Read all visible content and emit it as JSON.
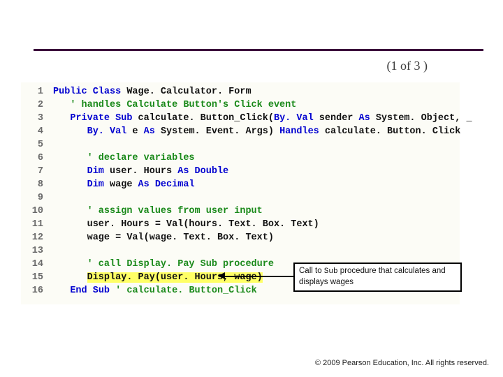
{
  "pager": "(1 of 3 )",
  "code": {
    "lines": [
      {
        "n": "1",
        "segs": [
          [
            "kw",
            "Public Class"
          ],
          [
            "id",
            " Wage. Calculator. Form"
          ]
        ]
      },
      {
        "n": "2",
        "indent": 1,
        "segs": [
          [
            "cm",
            "' handles Calculate Button's Click event"
          ]
        ]
      },
      {
        "n": "3",
        "indent": 1,
        "segs": [
          [
            "kw",
            "Private Sub"
          ],
          [
            "id",
            " calculate. Button_Click("
          ],
          [
            "kw",
            "By. Val"
          ],
          [
            "id",
            " sender "
          ],
          [
            "kw",
            "As"
          ],
          [
            "id",
            " System. Object, _"
          ]
        ]
      },
      {
        "n": "4",
        "indent": 2,
        "segs": [
          [
            "kw",
            "By. Val"
          ],
          [
            "id",
            " e "
          ],
          [
            "kw",
            "As"
          ],
          [
            "id",
            " System. Event. Args) "
          ],
          [
            "kw",
            "Handles"
          ],
          [
            "id",
            " calculate. Button. Click"
          ]
        ]
      },
      {
        "n": "5",
        "segs": []
      },
      {
        "n": "6",
        "indent": 2,
        "segs": [
          [
            "cm",
            "' declare variables"
          ]
        ]
      },
      {
        "n": "7",
        "indent": 2,
        "segs": [
          [
            "kw",
            "Dim"
          ],
          [
            "id",
            " user. Hours "
          ],
          [
            "kw",
            "As Double"
          ]
        ]
      },
      {
        "n": "8",
        "indent": 2,
        "segs": [
          [
            "kw",
            "Dim"
          ],
          [
            "id",
            " wage "
          ],
          [
            "kw",
            "As Decimal"
          ]
        ]
      },
      {
        "n": "9",
        "segs": []
      },
      {
        "n": "10",
        "indent": 2,
        "segs": [
          [
            "cm",
            "' assign values from user input"
          ]
        ]
      },
      {
        "n": "11",
        "indent": 2,
        "segs": [
          [
            "id",
            "user. Hours = Val(hours. Text. Box. Text)"
          ]
        ]
      },
      {
        "n": "12",
        "indent": 2,
        "segs": [
          [
            "id",
            "wage = Val(wage. Text. Box. Text)"
          ]
        ]
      },
      {
        "n": "13",
        "segs": []
      },
      {
        "n": "14",
        "indent": 2,
        "segs": [
          [
            "cm",
            "' call Display. Pay Sub procedure"
          ]
        ]
      },
      {
        "n": "15",
        "indent": 2,
        "hl": true,
        "segs": [
          [
            "id",
            "Display. Pay(user. Hours, wage)"
          ]
        ]
      },
      {
        "n": "16",
        "indent": 1,
        "segs": [
          [
            "kw",
            "End Sub"
          ],
          [
            "id",
            " "
          ],
          [
            "cm",
            "' calculate. Button_Click"
          ]
        ]
      }
    ]
  },
  "callout": {
    "pre": "Call to ",
    "code": "Sub",
    "post": " procedure that calculates and displays wages"
  },
  "footer": "© 2009 Pearson Education, Inc.  All rights reserved."
}
